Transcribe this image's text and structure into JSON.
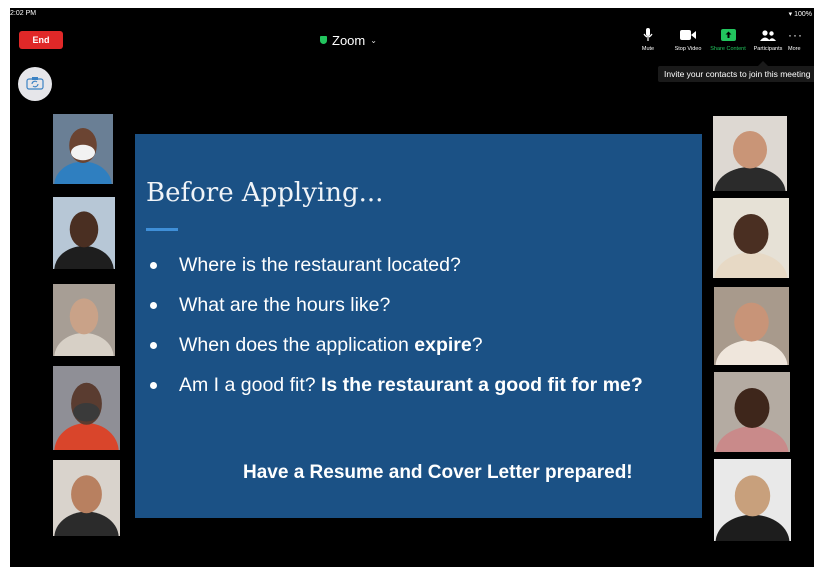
{
  "status_bar": {
    "time": "2:02 PM",
    "battery": "100%"
  },
  "header": {
    "end_label": "End",
    "title": "Zoom",
    "accent_green": "#22c55e",
    "end_color": "#e02828"
  },
  "toolbar": {
    "items": [
      {
        "label": "Mute",
        "icon": "microphone-icon"
      },
      {
        "label": "Stop Video",
        "icon": "video-camera-icon"
      },
      {
        "label": "Share Content",
        "icon": "share-screen-icon"
      },
      {
        "label": "Participants",
        "icon": "participants-icon"
      },
      {
        "label": "More",
        "icon": "more-dots-icon"
      }
    ]
  },
  "tooltip": {
    "text": "Invite your contacts to join this meeting"
  },
  "slide": {
    "title": "Before Applying...",
    "bullets": [
      {
        "text": "Where is the restaurant located?",
        "bold": "",
        "suffix": ""
      },
      {
        "text": "What are the hours like?",
        "bold": "",
        "suffix": ""
      },
      {
        "text": "When does the application ",
        "bold": "expire",
        "suffix": "?"
      },
      {
        "text": "Am I a good fit? ",
        "bold": "Is the restaurant a good fit for me?",
        "suffix": ""
      }
    ],
    "cta": "Have a Resume and Cover Letter prepared!",
    "background": "#1b5185"
  },
  "participants": {
    "left": [
      {
        "name": "participant-left-1",
        "bg": "#6a7f95",
        "skin": "#6b4432",
        "shirt": "#2f7fc0",
        "mask": "#f2f2f2"
      },
      {
        "name": "participant-left-2",
        "bg": "#b7c7d6",
        "skin": "#4a2f22",
        "shirt": "#1e1e1e",
        "mask": ""
      },
      {
        "name": "participant-left-3",
        "bg": "#a79e95",
        "skin": "#c9a288",
        "shirt": "#d7d0c6",
        "mask": ""
      },
      {
        "name": "participant-left-4",
        "bg": "#8f8f96",
        "skin": "#5a3c30",
        "shirt": "#d9452b",
        "mask": "#3a3a3a"
      },
      {
        "name": "participant-left-5",
        "bg": "#d9d3cc",
        "skin": "#b88060",
        "shirt": "#2b2b2b",
        "mask": ""
      }
    ],
    "right": [
      {
        "name": "participant-right-1",
        "bg": "#ddd8d2",
        "skin": "#c99577",
        "shirt": "#2b2b2b",
        "mask": ""
      },
      {
        "name": "participant-right-2",
        "bg": "#e6e1d6",
        "skin": "#4a2f22",
        "shirt": "#e7d9c5",
        "mask": ""
      },
      {
        "name": "participant-right-3",
        "bg": "#a89a8c",
        "skin": "#c89478",
        "shirt": "#efe6dc",
        "mask": ""
      },
      {
        "name": "participant-right-4",
        "bg": "#b4aba2",
        "skin": "#3e261b",
        "shirt": "#c98a8a",
        "mask": ""
      },
      {
        "name": "participant-right-5",
        "bg": "#e9e9e9",
        "skin": "#c8a07c",
        "shirt": "#1d1d1d",
        "mask": ""
      }
    ]
  }
}
